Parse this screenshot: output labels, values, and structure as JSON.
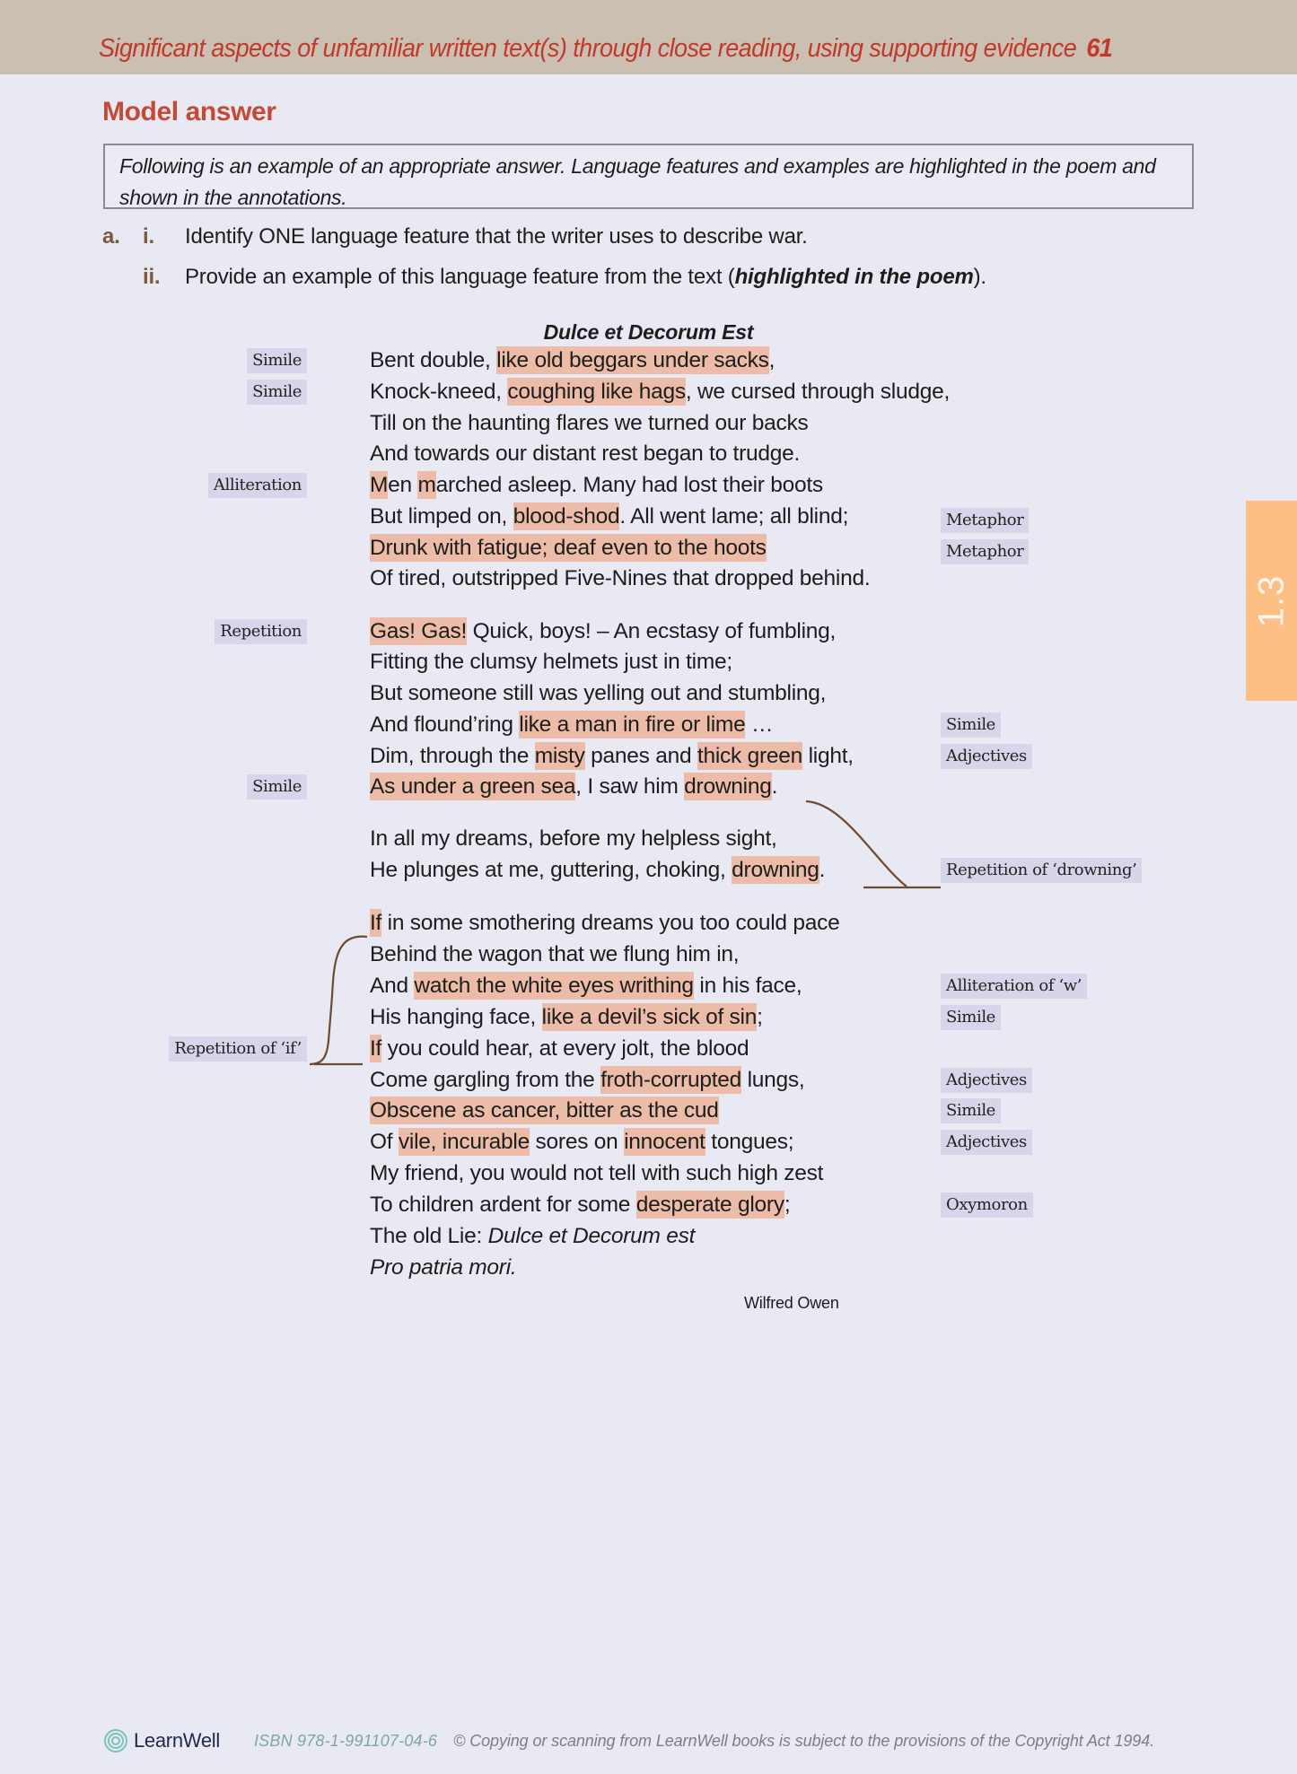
{
  "header": {
    "title": "Significant aspects of unfamiliar written text(s) through close reading, using supporting evidence",
    "page_number": "61"
  },
  "section_title": "Model answer",
  "intro": "Following is an example of an appropriate answer. Language features and examples are highlighted in the poem and shown in the annotations.",
  "questions": {
    "part_label": "a.",
    "items": [
      {
        "marker": "i.",
        "text": "Identify ONE language feature that the writer uses to describe war."
      },
      {
        "marker": "ii.",
        "text_before": "Provide an example of this language feature from the text (",
        "text_emphasis": "highlighted in the poem",
        "text_after": ")."
      }
    ]
  },
  "poem": {
    "title": "Dulce et Decorum Est",
    "author": "Wilfred Owen",
    "lines": [
      {
        "segments": [
          {
            "t": "Bent double, "
          },
          {
            "t": "like old beggars under sacks",
            "hl": true
          },
          {
            "t": ","
          }
        ]
      },
      {
        "segments": [
          {
            "t": "Knock-kneed, "
          },
          {
            "t": "coughing like hags",
            "hl": true
          },
          {
            "t": ", we cursed through sludge,"
          }
        ]
      },
      {
        "segments": [
          {
            "t": "Till on the haunting flares we turned our backs"
          }
        ]
      },
      {
        "segments": [
          {
            "t": "And towards our distant rest began to trudge."
          }
        ]
      },
      {
        "segments": [
          {
            "t": "M",
            "hl": true
          },
          {
            "t": "en "
          },
          {
            "t": "m",
            "hl": true
          },
          {
            "t": "arched asleep. Many had lost their boots"
          }
        ]
      },
      {
        "segments": [
          {
            "t": "But limped on, "
          },
          {
            "t": "blood-shod",
            "hl": true
          },
          {
            "t": ". All went lame; all blind;"
          }
        ]
      },
      {
        "segments": [
          {
            "t": "Drunk with fatigue; deaf even to the hoots",
            "hl": true
          }
        ]
      },
      {
        "segments": [
          {
            "t": "Of tired, outstripped Five-Nines that dropped behind."
          }
        ]
      },
      {
        "segments": [
          {
            "t": "Gas! Gas!",
            "hl": true
          },
          {
            "t": " Quick, boys! – An ecstasy of fumbling,"
          }
        ]
      },
      {
        "segments": [
          {
            "t": "Fitting the clumsy helmets just in time;"
          }
        ]
      },
      {
        "segments": [
          {
            "t": "But someone still was yelling out and stumbling,"
          }
        ]
      },
      {
        "segments": [
          {
            "t": "And flound’ring "
          },
          {
            "t": "like a man in fire or lime",
            "hl": true
          },
          {
            "t": " …"
          }
        ]
      },
      {
        "segments": [
          {
            "t": "Dim, through the "
          },
          {
            "t": "misty",
            "hl": true
          },
          {
            "t": " panes and "
          },
          {
            "t": "thick green",
            "hl": true
          },
          {
            "t": " light,"
          }
        ]
      },
      {
        "segments": [
          {
            "t": "As under a green sea",
            "hl": true
          },
          {
            "t": ", I saw him "
          },
          {
            "t": "drowning",
            "hl": true
          },
          {
            "t": "."
          }
        ]
      },
      {
        "segments": [
          {
            "t": "In all my dreams, before my helpless sight,"
          }
        ]
      },
      {
        "segments": [
          {
            "t": "He plunges at me, guttering, choking, "
          },
          {
            "t": "drowning",
            "hl": true
          },
          {
            "t": "."
          }
        ]
      },
      {
        "segments": [
          {
            "t": "If",
            "hl": true
          },
          {
            "t": " in some smothering dreams you too could pace"
          }
        ]
      },
      {
        "segments": [
          {
            "t": "Behind the wagon that we flung him in,"
          }
        ]
      },
      {
        "segments": [
          {
            "t": "And "
          },
          {
            "t": "watch the white eyes writhing",
            "hl": true
          },
          {
            "t": " in his face,"
          }
        ]
      },
      {
        "segments": [
          {
            "t": "His hanging face, "
          },
          {
            "t": "like a devil’s sick of sin",
            "hl": true
          },
          {
            "t": ";"
          }
        ]
      },
      {
        "segments": [
          {
            "t": "If",
            "hl": true
          },
          {
            "t": " you could hear, at every jolt, the blood"
          }
        ]
      },
      {
        "segments": [
          {
            "t": "Come gargling from the "
          },
          {
            "t": "froth-corrupted",
            "hl": true
          },
          {
            "t": " lungs,"
          }
        ]
      },
      {
        "segments": [
          {
            "t": "Obscene as cancer, bitter as the cud",
            "hl": true
          }
        ]
      },
      {
        "segments": [
          {
            "t": "Of "
          },
          {
            "t": "vile, incurable",
            "hl": true
          },
          {
            "t": " sores on "
          },
          {
            "t": "innocent",
            "hl": true
          },
          {
            "t": " tongues;"
          }
        ]
      },
      {
        "segments": [
          {
            "t": "My friend, you would not tell with such high zest"
          }
        ]
      },
      {
        "segments": [
          {
            "t": "To children ardent for some "
          },
          {
            "t": "desperate glory",
            "hl": true
          },
          {
            "t": ";"
          }
        ]
      },
      {
        "segments": [
          {
            "t": "The old Lie: "
          },
          {
            "t": "Dulce et Decorum est",
            "it": true
          }
        ]
      },
      {
        "segments": [
          {
            "t": "Pro patria mori.",
            "it": true
          }
        ]
      }
    ]
  },
  "annotations": {
    "left": [
      {
        "label": "Simile",
        "line": 0
      },
      {
        "label": "Simile",
        "line": 1
      },
      {
        "label": "Alliteration",
        "line": 4
      },
      {
        "label": "Repetition",
        "line": 8
      },
      {
        "label": "Simile",
        "line": 13
      },
      {
        "label": "Repetition of ‘if’",
        "line": 20
      }
    ],
    "right": [
      {
        "label": "Metaphor",
        "line": 5
      },
      {
        "label": "Metaphor",
        "line": 6
      },
      {
        "label": "Simile",
        "line": 11
      },
      {
        "label": "Adjectives",
        "line": 12
      },
      {
        "label": "Repetition of ‘drowning’",
        "line": 15
      },
      {
        "label": "Alliteration of ‘w’",
        "line": 18
      },
      {
        "label": "Simile",
        "line": 19
      },
      {
        "label": "Adjectives",
        "line": 21
      },
      {
        "label": "Simile",
        "line": 22
      },
      {
        "label": "Adjectives",
        "line": 23
      },
      {
        "label": "Oxymoron",
        "line": 25
      }
    ]
  },
  "side_tab": {
    "label": "1.3"
  },
  "footer": {
    "brand": "LearnWell",
    "isbn": "ISBN 978-1-991107-04-6",
    "copyright": "© Copying or scanning from LearnWell books is subject to the provisions of the Copyright Act 1994."
  },
  "colors": {
    "highlight": "#ecbca9",
    "annotation_bg": "#d6d5ea",
    "accent_red": "#c44a35",
    "side_tab": "#fdbf84",
    "header_band": "#cbbfb2"
  }
}
